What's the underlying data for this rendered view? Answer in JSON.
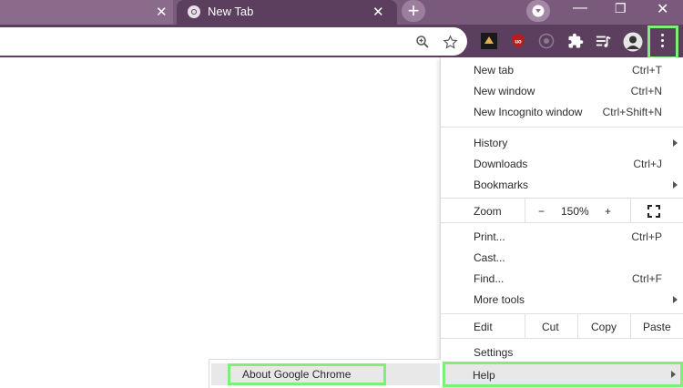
{
  "tabs": [
    {
      "title": "New Tab",
      "favicon": "chrome-icon"
    }
  ],
  "window_controls": {
    "minimize": "—",
    "restore": "❐",
    "close": "✕"
  },
  "tab_close_glyph": "✕",
  "new_tab_glyph": "+",
  "toolbar": {
    "icons": [
      "zoom-icon",
      "bookmark-star-icon",
      "extension-icon-1",
      "ublock-icon",
      "extension-icon-3",
      "extensions-puzzle-icon",
      "reading-list-icon",
      "profile-avatar-icon",
      "more-menu-icon"
    ]
  },
  "menu": {
    "new_tab": {
      "label": "New tab",
      "shortcut": "Ctrl+T"
    },
    "new_window": {
      "label": "New window",
      "shortcut": "Ctrl+N"
    },
    "new_incognito": {
      "label": "New Incognito window",
      "shortcut": "Ctrl+Shift+N"
    },
    "history": {
      "label": "History"
    },
    "downloads": {
      "label": "Downloads",
      "shortcut": "Ctrl+J"
    },
    "bookmarks": {
      "label": "Bookmarks"
    },
    "zoom": {
      "label": "Zoom",
      "minus": "−",
      "value": "150%",
      "plus": "+"
    },
    "print": {
      "label": "Print...",
      "shortcut": "Ctrl+P"
    },
    "cast": {
      "label": "Cast..."
    },
    "find": {
      "label": "Find...",
      "shortcut": "Ctrl+F"
    },
    "more_tools": {
      "label": "More tools"
    },
    "edit": {
      "label": "Edit",
      "cut": "Cut",
      "copy": "Copy",
      "paste": "Paste"
    },
    "settings": {
      "label": "Settings"
    },
    "help": {
      "label": "Help"
    }
  },
  "help_submenu": {
    "about": {
      "label": "About Google Chrome"
    }
  },
  "colors": {
    "tabstrip": "#7a5a7c",
    "toolbar": "#5c3f5e",
    "highlight": "#7df07a"
  }
}
